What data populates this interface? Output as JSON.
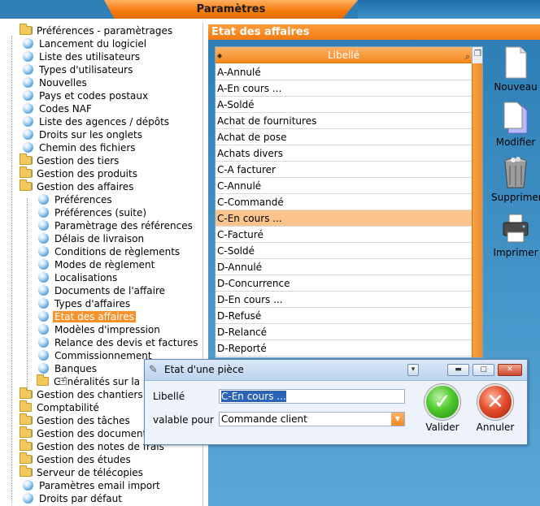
{
  "app": {
    "title": "Paramètres"
  },
  "tree": {
    "items": [
      {
        "label": "Préférences - paramètrages",
        "icon": "folder-icon",
        "expander": "-"
      },
      {
        "label": "Lancement du logiciel",
        "icon": "ball-icon"
      },
      {
        "label": "Liste des utilisateurs",
        "icon": "ball-icon"
      },
      {
        "label": "Types d'utilisateurs",
        "icon": "ball-icon"
      },
      {
        "label": "Nouvelles",
        "icon": "ball-icon"
      },
      {
        "label": "Pays et codes postaux",
        "icon": "ball-icon"
      },
      {
        "label": "Codes NAF",
        "icon": "ball-icon"
      },
      {
        "label": "Liste des agences / dépôts",
        "icon": "ball-icon"
      },
      {
        "label": "Droits sur les onglets",
        "icon": "ball-icon"
      },
      {
        "label": "Chemin des fichiers",
        "icon": "ball-icon"
      },
      {
        "label": "Gestion des tiers",
        "icon": "folder-icon",
        "expander": "+"
      },
      {
        "label": "Gestion des produits",
        "icon": "folder-icon",
        "expander": "+"
      },
      {
        "label": "Gestion des affaires",
        "icon": "folder-icon",
        "expander": "-"
      },
      {
        "label": "Préférences",
        "icon": "ball-icon"
      },
      {
        "label": "Préférences (suite)",
        "icon": "ball-icon"
      },
      {
        "label": "Paramètrage des références",
        "icon": "ball-icon"
      },
      {
        "label": "Délais de livraison",
        "icon": "ball-icon"
      },
      {
        "label": "Conditions de règlements",
        "icon": "ball-icon"
      },
      {
        "label": "Modes de règlement",
        "icon": "ball-icon"
      },
      {
        "label": "Localisations",
        "icon": "ball-icon"
      },
      {
        "label": "Documents de l'affaire",
        "icon": "ball-icon"
      },
      {
        "label": "Types d'affaires",
        "icon": "ball-icon"
      },
      {
        "label": "Etat des affaires",
        "icon": "ball-icon",
        "selected": true
      },
      {
        "label": "Modèles d'impression",
        "icon": "ball-icon"
      },
      {
        "label": "Relance des devis et factures",
        "icon": "ball-icon"
      },
      {
        "label": "Commissionnement",
        "icon": "ball-icon"
      },
      {
        "label": "Banques",
        "icon": "ball-icon"
      },
      {
        "label": "Généralités sur la p",
        "icon": "folder-icon",
        "expander": "+"
      },
      {
        "label": "Gestion des chantiers",
        "icon": "folder-icon",
        "expander": "+"
      },
      {
        "label": "Comptabilité",
        "icon": "folder-icon"
      },
      {
        "label": "Gestion des tâches",
        "icon": "folder-icon",
        "expander": "+"
      },
      {
        "label": "Gestion des documents",
        "icon": "folder-icon",
        "expander": "+"
      },
      {
        "label": "Gestion des notes de frais",
        "icon": "folder-icon",
        "expander": "+"
      },
      {
        "label": "Gestion des études",
        "icon": "folder-icon",
        "expander": "+"
      },
      {
        "label": "Serveur de télécopies",
        "icon": "folder-icon",
        "expander": "+"
      },
      {
        "label": "Paramètres email import",
        "icon": "ball-icon"
      },
      {
        "label": "Droits par défaut",
        "icon": "ball-icon"
      }
    ]
  },
  "panel": {
    "title": "Etat des affaires",
    "column_header": "Libellé",
    "rows": [
      "A-Annulé",
      "A-En cours ...",
      "A-Soldé",
      "Achat de fournitures",
      "Achat de pose",
      "Achats divers",
      "C-A facturer",
      "C-Annulé",
      "C-Commandé",
      "C-En cours ...",
      "C-Facturé",
      "C-Soldé",
      "D-Annulé",
      "D-Concurrence",
      "D-En cours ...",
      "D-Refusé",
      "D-Relancé",
      "D-Reporté"
    ],
    "selected_row": "C-En cours ..."
  },
  "actions": {
    "new_label": "Nouveau",
    "edit_label": "Modifier",
    "delete_label": "Supprimer",
    "print_label": "Imprimer"
  },
  "dialog": {
    "title": "Etat d'une pièce",
    "libelle_label": "Libellé",
    "libelle_value": "C-En cours ...",
    "valable_label": "valable pour",
    "valable_value": "Commande client",
    "validate_label": "Valider",
    "cancel_label": "Annuler"
  },
  "colors": {
    "accent_orange": "#f7932a",
    "frame_blue": "#2e7fb6",
    "selection_row": "#fbc48d"
  }
}
